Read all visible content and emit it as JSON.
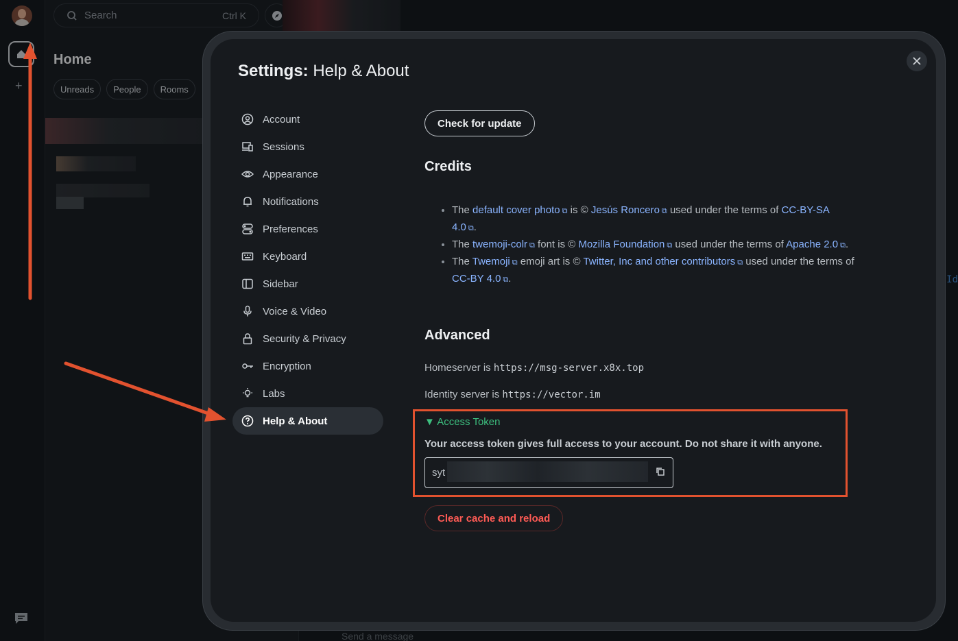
{
  "app": {
    "search_placeholder": "Search",
    "search_shortcut": "Ctrl K",
    "home_title": "Home",
    "filters": [
      "Unreads",
      "People",
      "Rooms"
    ],
    "composer_placeholder": "Send a message",
    "right_edge_hint": "Id"
  },
  "modal": {
    "title_bold": "Settings:",
    "title_rest": " Help & About",
    "close_icon": "close-icon"
  },
  "nav": {
    "items": [
      {
        "label": "Account",
        "icon": "account-icon"
      },
      {
        "label": "Sessions",
        "icon": "sessions-icon"
      },
      {
        "label": "Appearance",
        "icon": "eye-icon"
      },
      {
        "label": "Notifications",
        "icon": "bell-icon"
      },
      {
        "label": "Preferences",
        "icon": "preferences-icon"
      },
      {
        "label": "Keyboard",
        "icon": "keyboard-icon"
      },
      {
        "label": "Sidebar",
        "icon": "sidebar-icon"
      },
      {
        "label": "Voice & Video",
        "icon": "microphone-icon"
      },
      {
        "label": "Security & Privacy",
        "icon": "lock-icon"
      },
      {
        "label": "Encryption",
        "icon": "key-icon"
      },
      {
        "label": "Labs",
        "icon": "lightbulb-icon"
      },
      {
        "label": "Help & About",
        "icon": "help-icon",
        "active": true
      }
    ]
  },
  "content": {
    "check_update_label": "Check for update",
    "credits_heading": "Credits",
    "credits": {
      "c1_pre": "The ",
      "c1_link1": "default cover photo",
      "c1_mid1": " is © ",
      "c1_link2": "Jesús Roncero",
      "c1_mid2": " used under the terms of ",
      "c1_link3": "CC-BY-SA 4.0",
      "c1_end": ".",
      "c2_pre": "The ",
      "c2_link1": "twemoji-colr",
      "c2_mid1": " font is © ",
      "c2_link2": "Mozilla Foundation",
      "c2_mid2": " used under the terms of ",
      "c2_link3": "Apache 2.0",
      "c2_end": ".",
      "c3_pre": "The ",
      "c3_link1": "Twemoji",
      "c3_mid1": " emoji art is © ",
      "c3_link2": "Twitter, Inc and other contributors",
      "c3_mid2": " used under the terms of ",
      "c3_link3": "CC-BY 4.0",
      "c3_end": "."
    },
    "advanced_heading": "Advanced",
    "homeserver_label": "Homeserver is ",
    "homeserver_value": "https://msg-server.x8x.top",
    "identity_label": "Identity server is ",
    "identity_value": "https://vector.im",
    "access_token_summary": "Access Token",
    "access_token_warning": "Your access token gives full access to your account. Do not share it with anyone.",
    "access_token_prefix": "syt",
    "clear_cache_label": "Clear cache and reload"
  },
  "colors": {
    "accent_green": "#3dbf7f",
    "link_blue": "#8ab4ff",
    "danger_red": "#ff5b55",
    "annotation_red": "#e2522f"
  }
}
